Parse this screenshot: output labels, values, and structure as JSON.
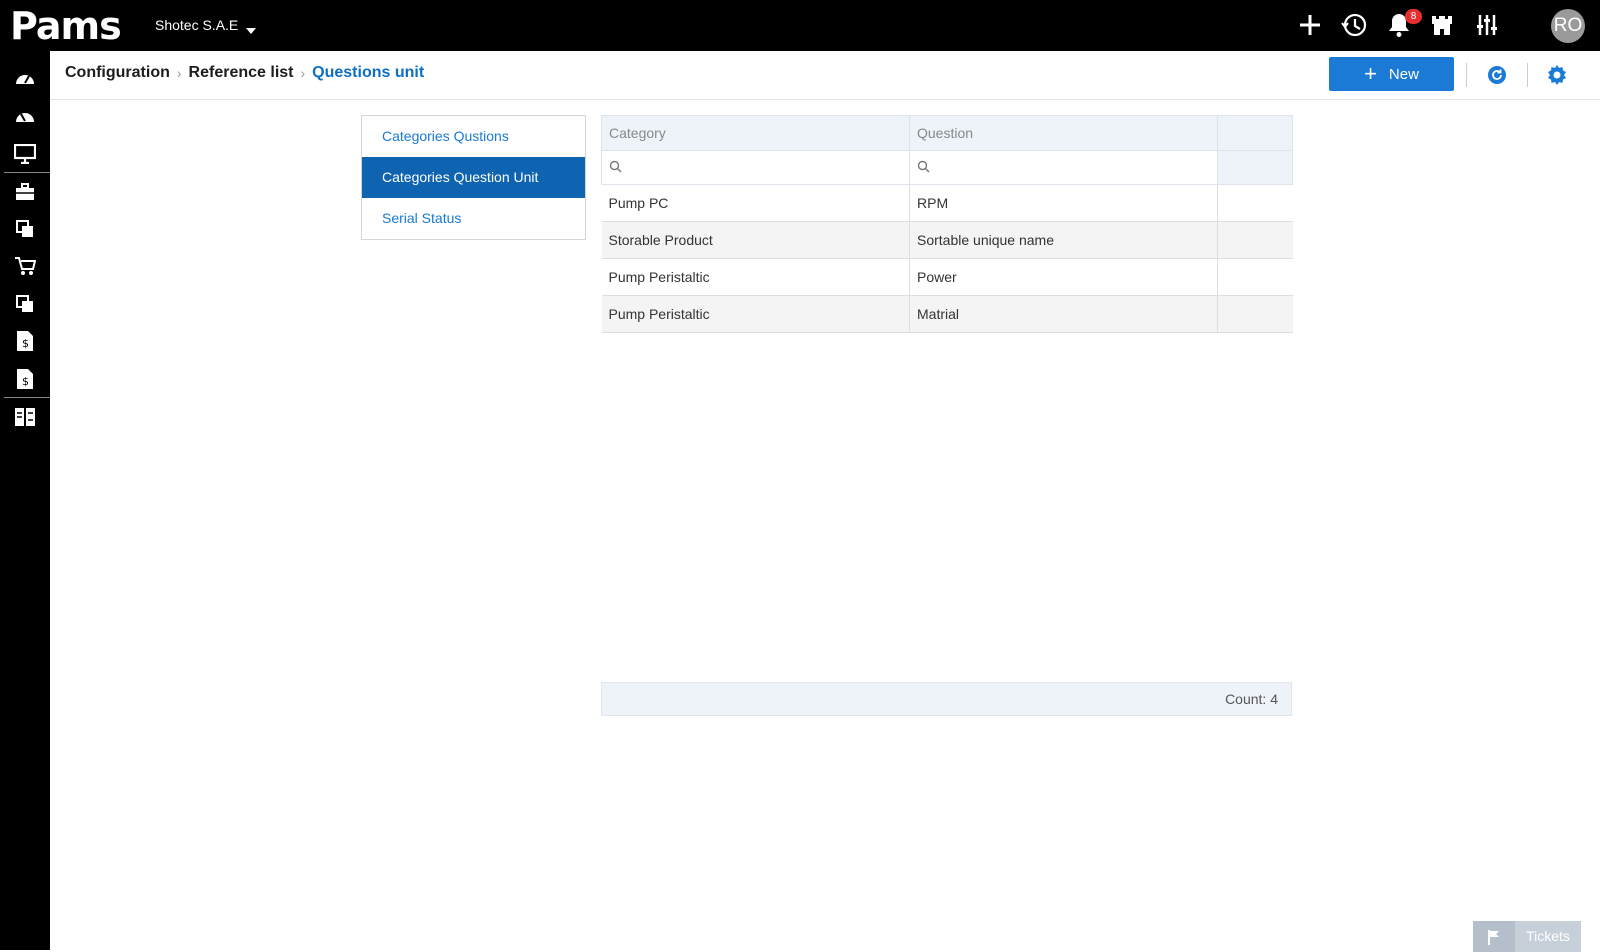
{
  "topbar": {
    "logo_text": "Pams",
    "company": "Shotec S.A.E",
    "notification_count": "8",
    "avatar_initials": "RO"
  },
  "sidebar": {
    "items": [
      "dashboard-icon",
      "dashboard-alt-icon",
      "monitor-icon",
      "briefcase-icon",
      "documents-icon",
      "cart-icon",
      "documents-alt-icon",
      "invoice-icon",
      "invoice-alt-icon",
      "modules-icon"
    ]
  },
  "breadcrumb": {
    "items": [
      "Configuration",
      "Reference list"
    ],
    "current": "Questions unit"
  },
  "header": {
    "new_label": "New"
  },
  "list": {
    "items": [
      "Categories Qustions",
      "Categories Question Unit",
      "Serial Status"
    ],
    "active_index": 1
  },
  "grid": {
    "columns": [
      "Category",
      "Question"
    ],
    "rows": [
      {
        "category": "Pump PC",
        "question": "RPM"
      },
      {
        "category": "Storable Product",
        "question": "Sortable unique name"
      },
      {
        "category": "Pump Peristaltic",
        "question": "Power"
      },
      {
        "category": "Pump Peristaltic",
        "question": "Matrial"
      }
    ],
    "count_label": "Count: 4"
  },
  "tickets": {
    "label": "Tickets"
  },
  "colors": {
    "accent": "#1a7ad6",
    "active_item": "#0e64b0",
    "topbar": "#000000"
  }
}
